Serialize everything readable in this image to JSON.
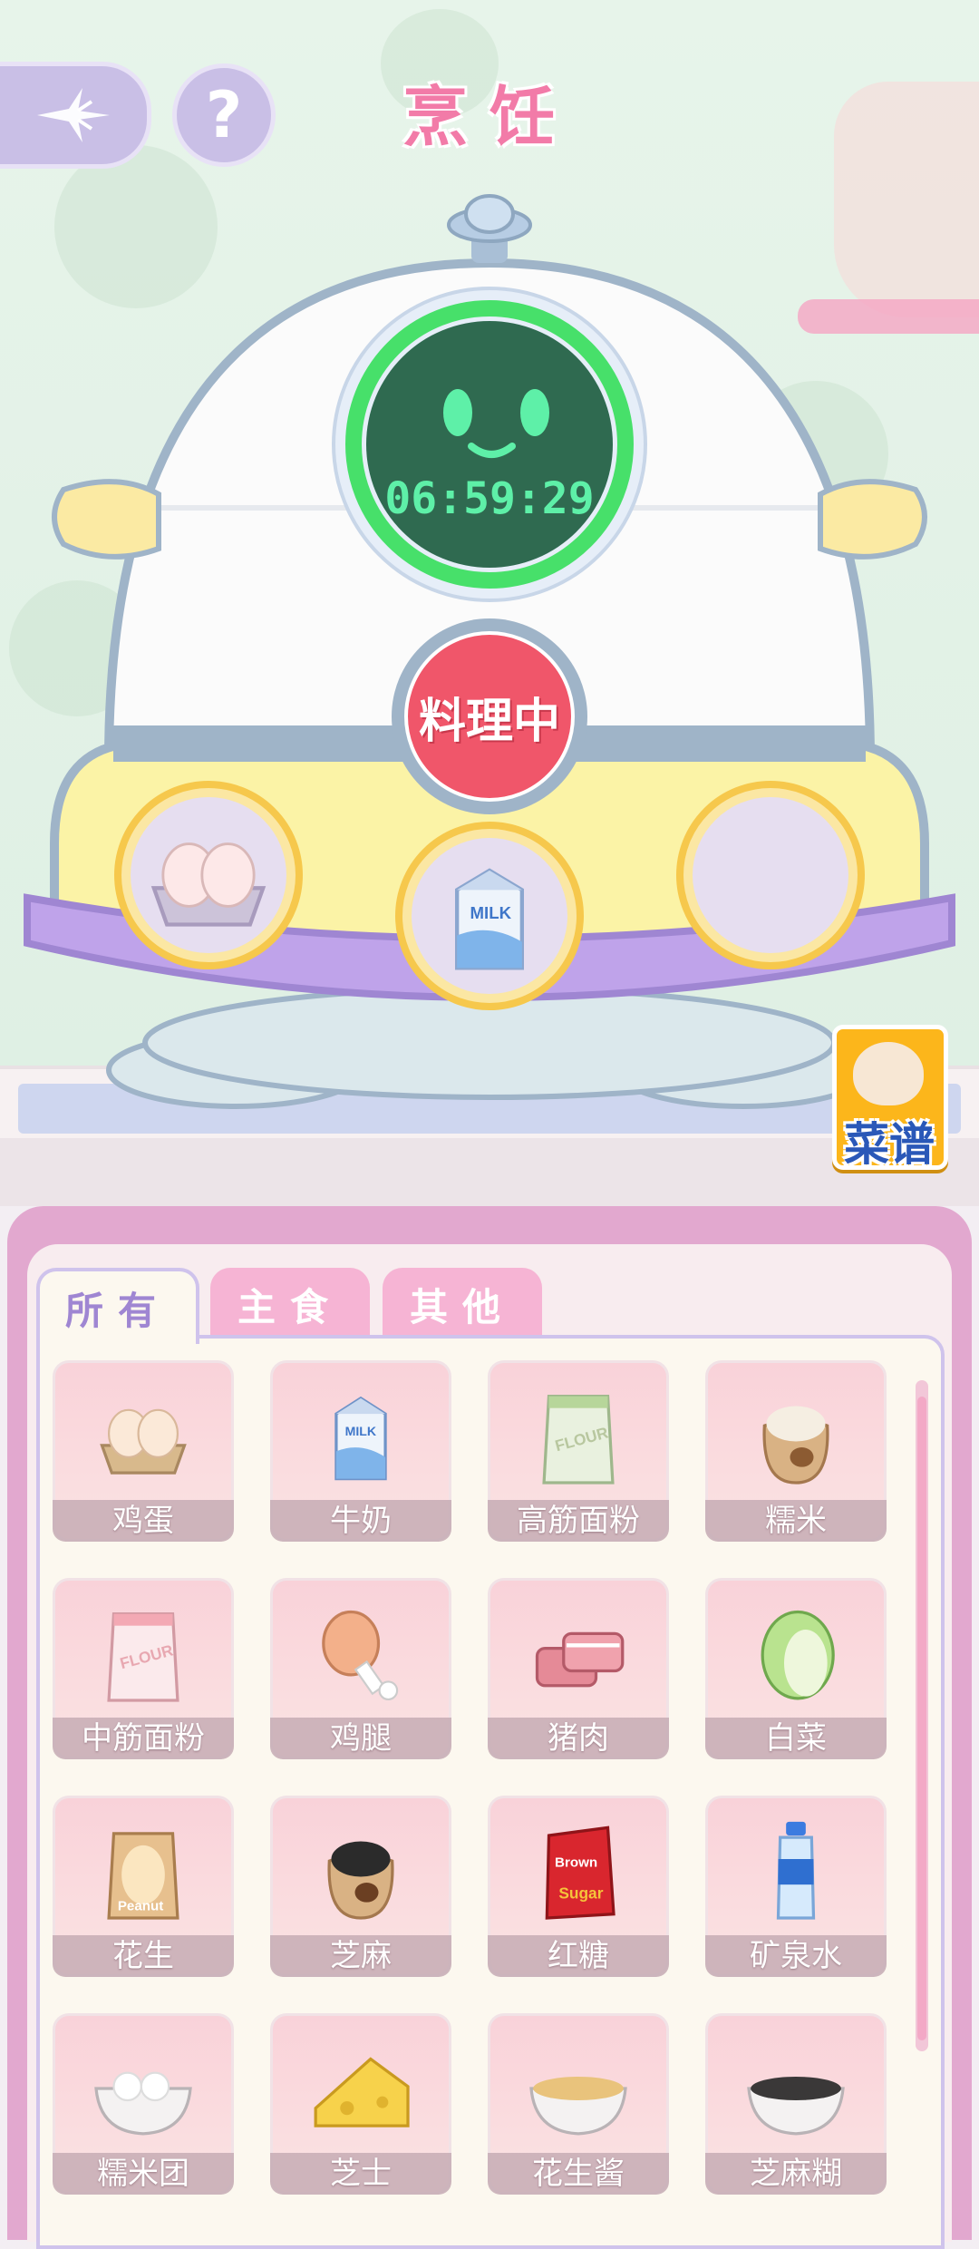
{
  "header": {
    "title": "烹饪",
    "back_icon": "compass-star-icon",
    "help_label": "?"
  },
  "cooker": {
    "timer": "06:59:29",
    "status_button": "料理中",
    "slots": [
      {
        "item": "egg-carton-icon"
      },
      {
        "item": "milk-carton-icon"
      },
      {
        "item": ""
      }
    ]
  },
  "recipe_book": {
    "label": "菜谱"
  },
  "tabs": [
    {
      "label": "所有",
      "active": true
    },
    {
      "label": "主食",
      "active": false
    },
    {
      "label": "其他",
      "active": false
    }
  ],
  "items": [
    {
      "name": "鸡蛋",
      "icon": "egg-carton-icon"
    },
    {
      "name": "牛奶",
      "icon": "milk-carton-icon"
    },
    {
      "name": "高筋面粉",
      "icon": "flour-bag-icon"
    },
    {
      "name": "糯米",
      "icon": "rice-sack-icon"
    },
    {
      "name": "中筋面粉",
      "icon": "flour-bag-pink-icon"
    },
    {
      "name": "鸡腿",
      "icon": "chicken-leg-icon"
    },
    {
      "name": "猪肉",
      "icon": "pork-icon"
    },
    {
      "name": "白菜",
      "icon": "cabbage-icon"
    },
    {
      "name": "花生",
      "icon": "peanut-bag-icon"
    },
    {
      "name": "芝麻",
      "icon": "sesame-sack-icon"
    },
    {
      "name": "红糖",
      "icon": "brown-sugar-icon"
    },
    {
      "name": "矿泉水",
      "icon": "water-bottle-icon"
    },
    {
      "name": "糯米团",
      "icon": "rice-ball-bowl-icon"
    },
    {
      "name": "芝士",
      "icon": "cheese-icon"
    },
    {
      "name": "花生酱",
      "icon": "peanut-butter-bowl-icon"
    },
    {
      "name": "芝麻糊",
      "icon": "sesame-paste-bowl-icon"
    }
  ],
  "colors": {
    "accent_pink": "#f27ba8",
    "timer_green": "#5ef0a8",
    "button_red": "#f0566a",
    "tab_purple": "#9f86d2"
  }
}
